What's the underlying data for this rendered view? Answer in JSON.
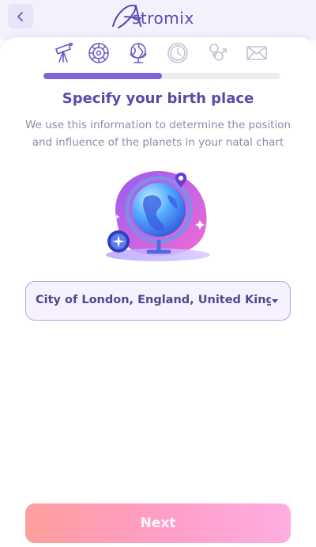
{
  "header": {
    "logo_letter": "A",
    "logo_text": "stromix",
    "back_icon": "chevron-left-icon"
  },
  "steps": [
    {
      "icon": "telescope-icon",
      "state": "done"
    },
    {
      "icon": "zodiac-wheel-icon",
      "state": "done"
    },
    {
      "icon": "globe-icon",
      "state": "current"
    },
    {
      "icon": "clock-icon",
      "state": "pending"
    },
    {
      "icon": "gender-icon",
      "state": "pending"
    },
    {
      "icon": "envelope-icon",
      "state": "pending"
    }
  ],
  "progress": {
    "fraction": 0.5
  },
  "main": {
    "title": "Specify your birth place",
    "subtitle_line1": "We use this information to determine the position",
    "subtitle_line2": "and influence of the planets in your natal chart",
    "illustration": "globe-illustration"
  },
  "place_select": {
    "value": "City of London, England, United Kingdom"
  },
  "footer": {
    "next_label": "Next"
  },
  "colors": {
    "accent": "#7d63d6",
    "title": "#5a4aa9",
    "step_active": "#6a56c2",
    "step_inactive": "#c4c0d6",
    "button_start": "#ff9e9c",
    "button_end": "#ffaee0"
  }
}
